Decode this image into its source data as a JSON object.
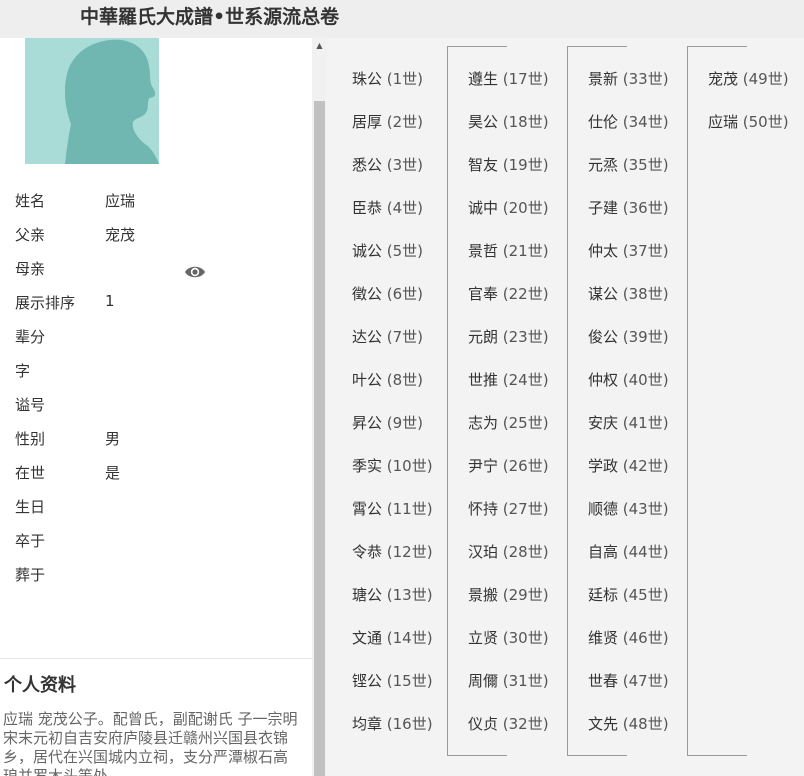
{
  "header": {
    "title": "中華羅氏大成譜•世系源流总卷"
  },
  "profile": {
    "avatar_icon": "person-silhouette-icon",
    "fields": [
      {
        "label": "姓名",
        "value": "应瑞"
      },
      {
        "label": "父亲",
        "value": "宠茂"
      },
      {
        "label": "母亲",
        "value": ""
      },
      {
        "label": "展示排序",
        "value": "1"
      },
      {
        "label": "辈分",
        "value": ""
      },
      {
        "label": "字",
        "value": ""
      },
      {
        "label": "谥号",
        "value": ""
      },
      {
        "label": "性别",
        "value": "男"
      },
      {
        "label": "在世",
        "value": "是"
      },
      {
        "label": "生日",
        "value": ""
      },
      {
        "label": "卒于",
        "value": ""
      },
      {
        "label": "葬于",
        "value": ""
      }
    ],
    "father_view_icon": "eye-icon"
  },
  "section": {
    "title": "个人资料",
    "bio_line1": "应瑞  宠茂公子。配曾氏，副配谢氏  子一宗明",
    "bio_line2": "宋末元初自吉安府庐陵县迁赣州兴国县衣锦乡，居代在兴国城内立祠，支分严潭椒石高琅并罗木头等处。"
  },
  "generations": {
    "columns": [
      [
        {
          "name": "珠公",
          "gen": "(1世)"
        },
        {
          "name": "居厚",
          "gen": "(2世)"
        },
        {
          "name": "悉公",
          "gen": "(3世)"
        },
        {
          "name": "臣恭",
          "gen": "(4世)"
        },
        {
          "name": "诚公",
          "gen": "(5世)"
        },
        {
          "name": "徵公",
          "gen": "(6世)"
        },
        {
          "name": "达公",
          "gen": "(7世)"
        },
        {
          "name": "叶公",
          "gen": "(8世)"
        },
        {
          "name": "昇公",
          "gen": "(9世)"
        },
        {
          "name": "季实",
          "gen": "(10世)"
        },
        {
          "name": "霄公",
          "gen": "(11世)"
        },
        {
          "name": "令恭",
          "gen": "(12世)"
        },
        {
          "name": "瑭公",
          "gen": "(13世)"
        },
        {
          "name": "文通",
          "gen": "(14世)"
        },
        {
          "name": "铿公",
          "gen": "(15世)"
        },
        {
          "name": "均章",
          "gen": "(16世)"
        }
      ],
      [
        {
          "name": "遵生",
          "gen": "(17世)"
        },
        {
          "name": "昊公",
          "gen": "(18世)"
        },
        {
          "name": "智友",
          "gen": "(19世)"
        },
        {
          "name": "诚中",
          "gen": "(20世)"
        },
        {
          "name": "景哲",
          "gen": "(21世)"
        },
        {
          "name": "官奉",
          "gen": "(22世)"
        },
        {
          "name": "元朗",
          "gen": "(23世)"
        },
        {
          "name": "世推",
          "gen": "(24世)"
        },
        {
          "name": "志为",
          "gen": "(25世)"
        },
        {
          "name": "尹宁",
          "gen": "(26世)"
        },
        {
          "name": "怀持",
          "gen": "(27世)"
        },
        {
          "name": "汉珀",
          "gen": "(28世)"
        },
        {
          "name": "景搬",
          "gen": "(29世)"
        },
        {
          "name": "立贤",
          "gen": "(30世)"
        },
        {
          "name": "周儞",
          "gen": "(31世)"
        },
        {
          "name": "仪贞",
          "gen": "(32世)"
        }
      ],
      [
        {
          "name": "景新",
          "gen": "(33世)"
        },
        {
          "name": "仕伦",
          "gen": "(34世)"
        },
        {
          "name": "元烝",
          "gen": "(35世)"
        },
        {
          "name": "子建",
          "gen": "(36世)"
        },
        {
          "name": "仲太",
          "gen": "(37世)"
        },
        {
          "name": "谋公",
          "gen": "(38世)"
        },
        {
          "name": "俊公",
          "gen": "(39世)"
        },
        {
          "name": "仲权",
          "gen": "(40世)"
        },
        {
          "name": "安庆",
          "gen": "(41世)"
        },
        {
          "name": "学政",
          "gen": "(42世)"
        },
        {
          "name": "顺德",
          "gen": "(43世)"
        },
        {
          "name": "自高",
          "gen": "(44世)"
        },
        {
          "name": "廷标",
          "gen": "(45世)"
        },
        {
          "name": "维贤",
          "gen": "(46世)"
        },
        {
          "name": "世春",
          "gen": "(47世)"
        },
        {
          "name": "文先",
          "gen": "(48世)"
        }
      ],
      [
        {
          "name": "宠茂",
          "gen": "(49世)"
        },
        {
          "name": "应瑞",
          "gen": "(50世)"
        }
      ]
    ]
  },
  "colors": {
    "avatar_bg": "#a9dcd6",
    "silhouette": "#6fb7b0",
    "panel_bg": "#f3f3f3"
  }
}
